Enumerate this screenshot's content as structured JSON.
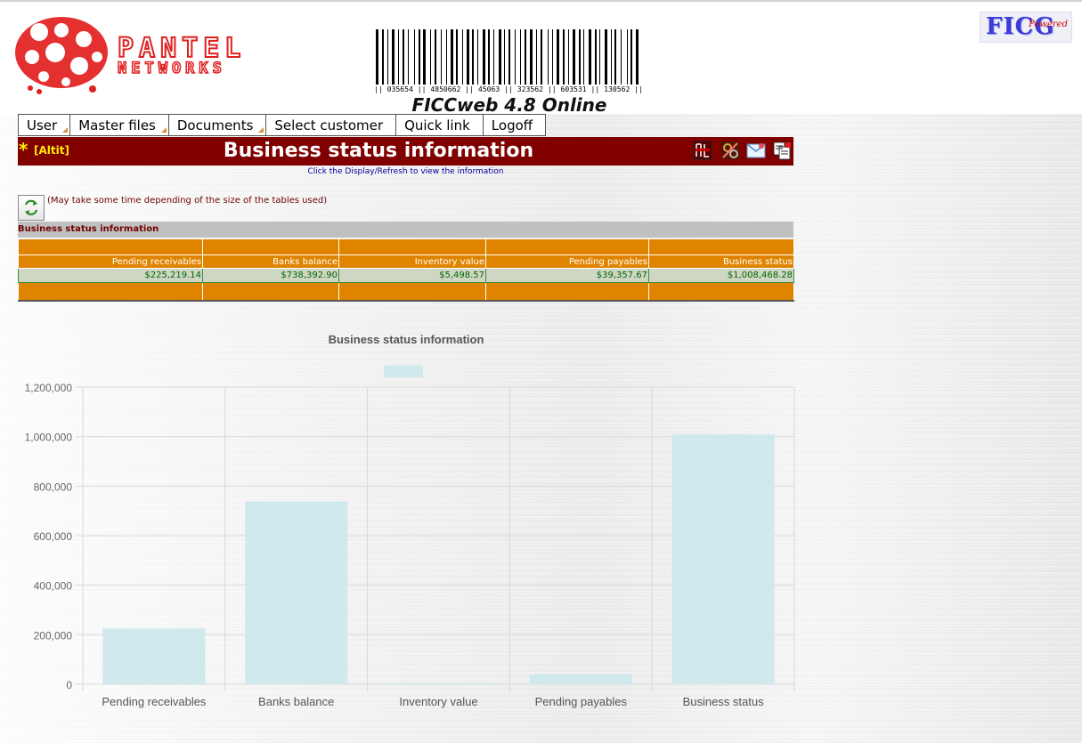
{
  "header": {
    "logo_text": "PANTEL NETWORKS",
    "barcode_text": "|| 035654 || 4850662 || 45063 || 323562 || 603531 || 130562 ||",
    "product_title": "FICCweb 4.8 Online",
    "ficg_text": "FICG",
    "ficg_powered": "Powered"
  },
  "menu": {
    "items": [
      {
        "label": "User",
        "has_arrow": true
      },
      {
        "label": "Master files",
        "has_arrow": true
      },
      {
        "label": "Documents",
        "has_arrow": true
      },
      {
        "label": "Select customer",
        "has_arrow": false
      },
      {
        "label": "Quick link",
        "has_arrow": false
      },
      {
        "label": "Logoff",
        "has_arrow": false
      }
    ]
  },
  "titlebar": {
    "star": "*",
    "company": "[Altit]",
    "title": "Business status information",
    "icons": [
      "pdf-export-icon",
      "settings-icon",
      "email-icon",
      "copy-icon"
    ]
  },
  "hint": "Click the Display/Refresh to view the information",
  "refresh_note": "(May take some time depending of the size of the tables used)",
  "table": {
    "section_title": "Business status information",
    "columns": [
      "Pending receivables",
      "Banks balance",
      "Inventory value",
      "Pending payables",
      "Business status"
    ],
    "values": [
      "$225,219.14",
      "$738,392.90",
      "$5,498.57",
      "$39,357.67",
      "$1,008,468.28"
    ]
  },
  "chart_data": {
    "type": "bar",
    "title": "Business status information",
    "categories": [
      "Pending receivables",
      "Banks balance",
      "Inventory value",
      "Pending payables",
      "Business status"
    ],
    "values": [
      225219.14,
      738392.9,
      5498.57,
      39357.67,
      1008468.28
    ],
    "ylim": [
      0,
      1200000
    ],
    "yticks": [
      0,
      200000,
      400000,
      600000,
      800000,
      1000000,
      1200000
    ],
    "ytick_labels": [
      "0",
      "200,000",
      "400,000",
      "600,000",
      "800,000",
      "1,000,000",
      "1,200,000"
    ],
    "grid": true,
    "legend": "top",
    "bar_color": "#cfe9ec"
  }
}
